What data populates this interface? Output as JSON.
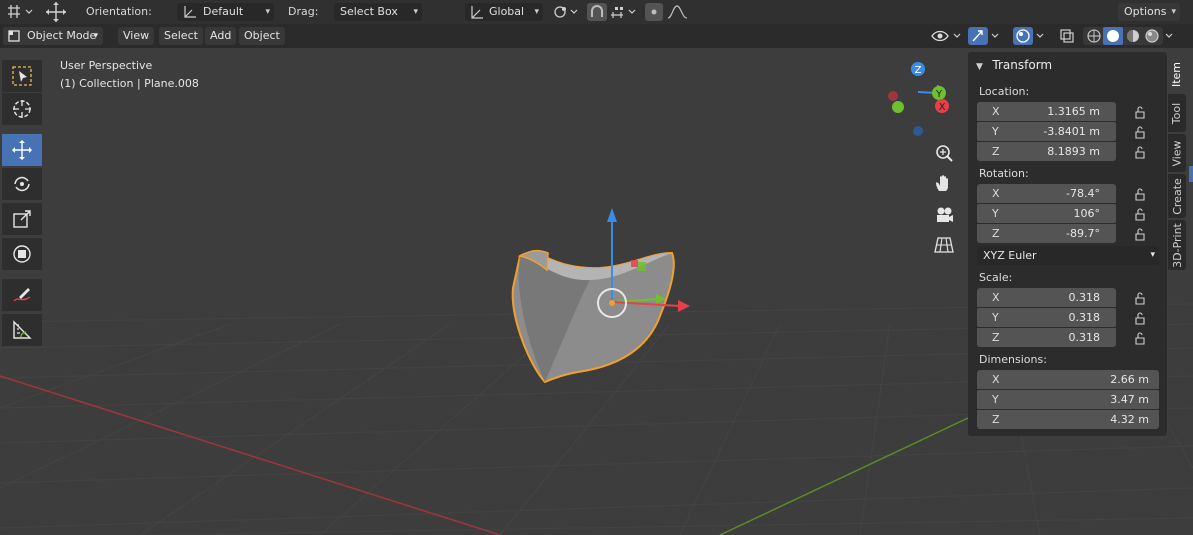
{
  "header": {
    "orientation_label": "Orientation:",
    "orientation_value": "Default",
    "drag_label": "Drag:",
    "drag_value": "Select Box",
    "transform_space": "Global",
    "options_label": "Options"
  },
  "menubar": {
    "mode": "Object Mode",
    "items": [
      "View",
      "Select",
      "Add",
      "Object"
    ]
  },
  "viewport": {
    "perspective_text": "User Perspective",
    "collection_text": "(1) Collection | Plane.008",
    "gizmo_axes": [
      "Z",
      "Y",
      "X"
    ]
  },
  "panel": {
    "title": "Transform",
    "location_label": "Location:",
    "location": [
      {
        "axis": "X",
        "value": "1.3165 m"
      },
      {
        "axis": "Y",
        "value": "-3.8401 m"
      },
      {
        "axis": "Z",
        "value": "8.1893 m"
      }
    ],
    "rotation_label": "Rotation:",
    "rotation": [
      {
        "axis": "X",
        "value": "-78.4°"
      },
      {
        "axis": "Y",
        "value": "106°"
      },
      {
        "axis": "Z",
        "value": "-89.7°"
      }
    ],
    "rotation_mode": "XYZ Euler",
    "scale_label": "Scale:",
    "scale": [
      {
        "axis": "X",
        "value": "0.318"
      },
      {
        "axis": "Y",
        "value": "0.318"
      },
      {
        "axis": "Z",
        "value": "0.318"
      }
    ],
    "dimensions_label": "Dimensions:",
    "dimensions": [
      {
        "axis": "X",
        "value": "2.66 m"
      },
      {
        "axis": "Y",
        "value": "3.47 m"
      },
      {
        "axis": "Z",
        "value": "4.32 m"
      }
    ]
  },
  "tabs": [
    "Item",
    "Tool",
    "View",
    "Create",
    "3D-Print"
  ],
  "colors": {
    "accent": "#4772b3",
    "selection_outline": "#f0a030",
    "axis_x": "#e8404a",
    "axis_y": "#6ec02e",
    "axis_z": "#3a8ce6"
  }
}
